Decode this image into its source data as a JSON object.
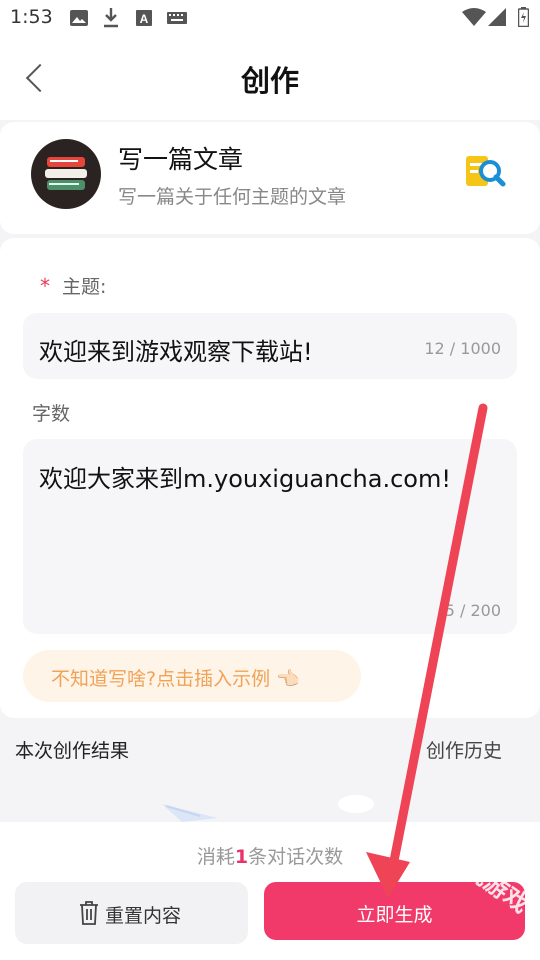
{
  "status_bar": {
    "time": "1:53",
    "icons": [
      "image-icon",
      "download-icon",
      "font-icon",
      "keyboard-icon",
      "wifi-icon",
      "signal-icon",
      "battery-icon"
    ]
  },
  "header": {
    "title": "创作"
  },
  "template": {
    "title": "写一篇文章",
    "subtitle": "写一篇关于任何主题的文章"
  },
  "form": {
    "topic_required_mark": "*",
    "topic_label": "主题:",
    "topic_value": "欢迎来到游戏观察下载站!",
    "topic_count": "12 / 1000",
    "words_label": "字数",
    "words_value": "欢迎大家来到m.youxiguancha.com!",
    "words_count": "5 / 200",
    "hint": "不知道写啥?点击插入示例 👈🏻"
  },
  "results": {
    "title": "本次创作结果",
    "history_link": "创作历史"
  },
  "bottom": {
    "cost_prefix": "消耗",
    "cost_number": "1",
    "cost_suffix": "条对话次数",
    "reset_label": "重置内容",
    "generate_label": "立即生成"
  },
  "watermark": "趣玩游戏",
  "colors": {
    "accent": "#f23a6a",
    "annotation_arrow": "#ef4356",
    "hint_bg": "#fff4e8",
    "hint_text": "#f0a357"
  }
}
